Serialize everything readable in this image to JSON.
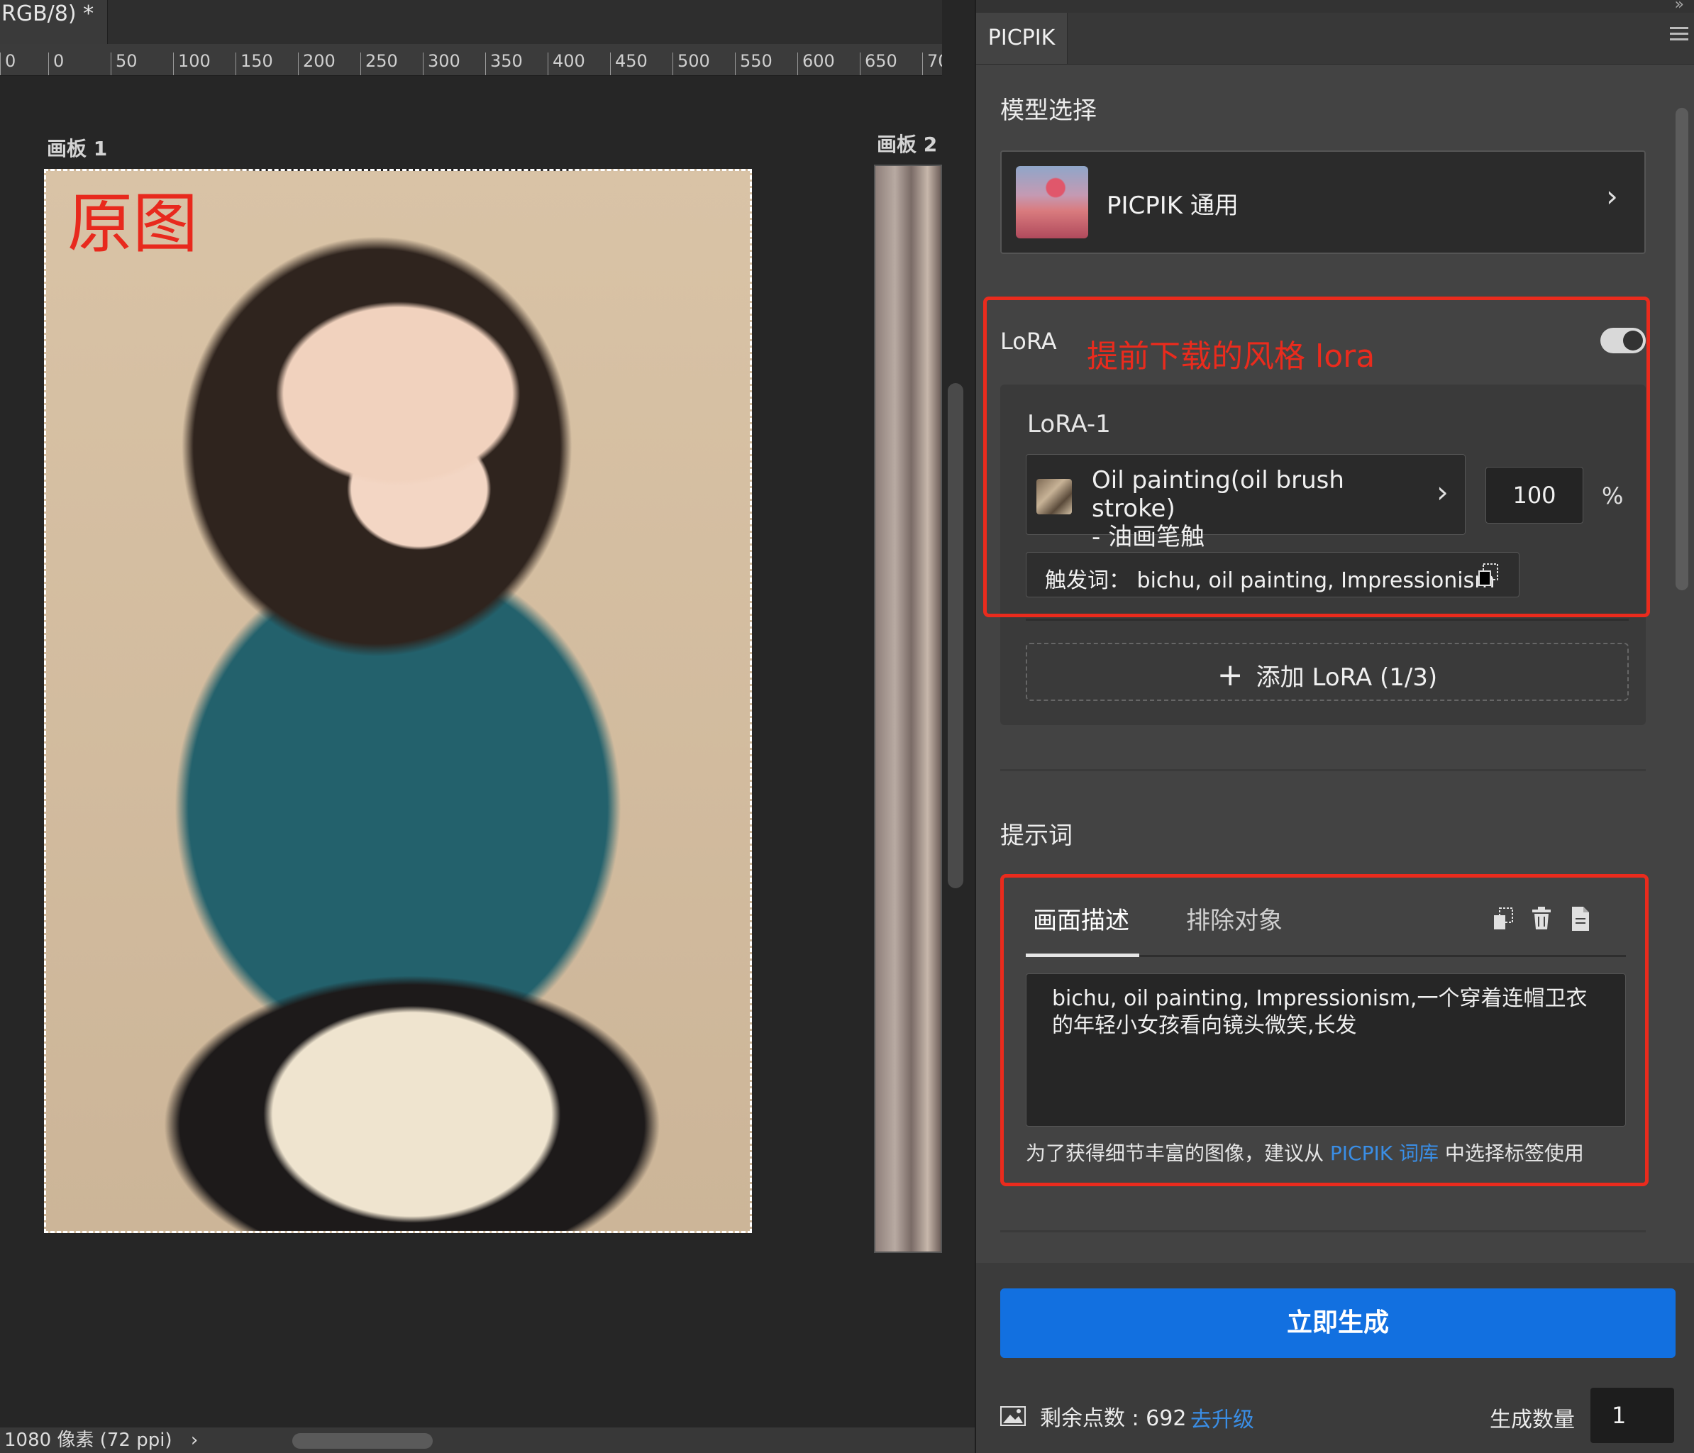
{
  "document": {
    "tab_title": "RGB/8) *",
    "ruler_ticks": [
      "0",
      "0",
      "50",
      "100",
      "150",
      "200",
      "250",
      "300",
      "350",
      "400",
      "450",
      "500",
      "550",
      "600",
      "650",
      "70"
    ],
    "artboards": [
      "画板 1",
      "画板 2"
    ],
    "overlay_label": "原图",
    "status_text": "1080 像素 (72 ppi)",
    "status_chevron": "›"
  },
  "panel": {
    "tab": "PICPIK",
    "model_section": {
      "title": "模型选择",
      "model_name": "PICPIK 通用",
      "chevron": "›"
    },
    "lora": {
      "title": "LoRA",
      "annotation": "提前下载的风格 lora",
      "enabled": true,
      "items": [
        {
          "label": "LoRA-1",
          "name_line1": "Oil painting(oil brush stroke)",
          "name_line2": "- 油画笔触",
          "weight": "100",
          "unit": "%",
          "trigger": "触发词：  bichu, oil painting, Impressionism"
        }
      ],
      "add_button": "添加 LoRA (1/3)",
      "add_icon": "+"
    },
    "prompt": {
      "title": "提示词",
      "tabs": [
        "画面描述",
        "排除对象"
      ],
      "active_tab": 0,
      "text": "bichu, oil painting, Impressionism,一个穿着连帽卫衣的年轻小女孩看向镜头微笑,长发",
      "tip_before": "为了获得细节丰富的图像，建议从 ",
      "tip_link": "PICPIK 词库",
      "tip_after": " 中选择标签使用"
    },
    "generate_button": "立即生成",
    "points_text": "剩余点数 : 692",
    "upgrade_link": "去升级",
    "quantity_label": "生成数量",
    "quantity_value": "1",
    "colors": {
      "accent_blue": "#1270e0",
      "annotation_red": "#ea2b1d",
      "link_blue": "#3a8ee6"
    },
    "icons": [
      "menu-icon",
      "copy-icon",
      "trash-icon",
      "document-icon",
      "image-icon",
      "plus-icon",
      "chevron-right-icon",
      "toggle-switch"
    ]
  }
}
